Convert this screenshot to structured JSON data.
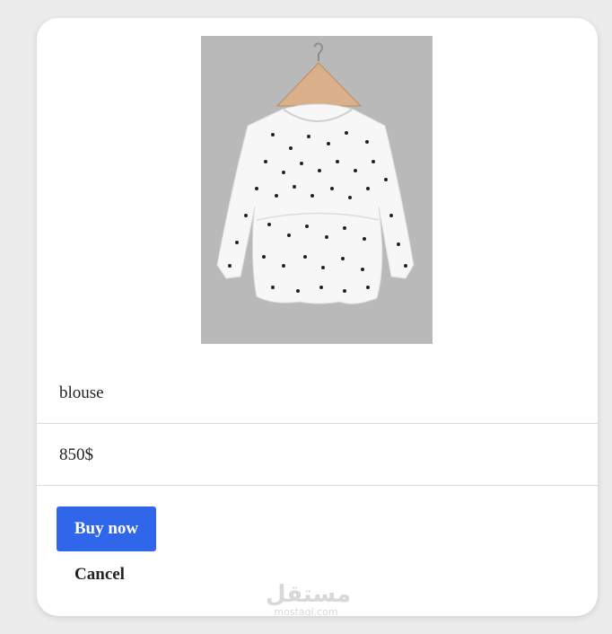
{
  "product": {
    "name": "blouse",
    "price": "850$",
    "image_icon": "blouse-photo"
  },
  "actions": {
    "buy_label": "Buy now",
    "cancel_label": "Cancel"
  },
  "watermark": {
    "main": "مستقل",
    "sub": "mostaql.com"
  },
  "colors": {
    "background": "#ececec",
    "card": "#ffffff",
    "buy_button": "#2f66ea",
    "divider": "#dcdcdc"
  }
}
